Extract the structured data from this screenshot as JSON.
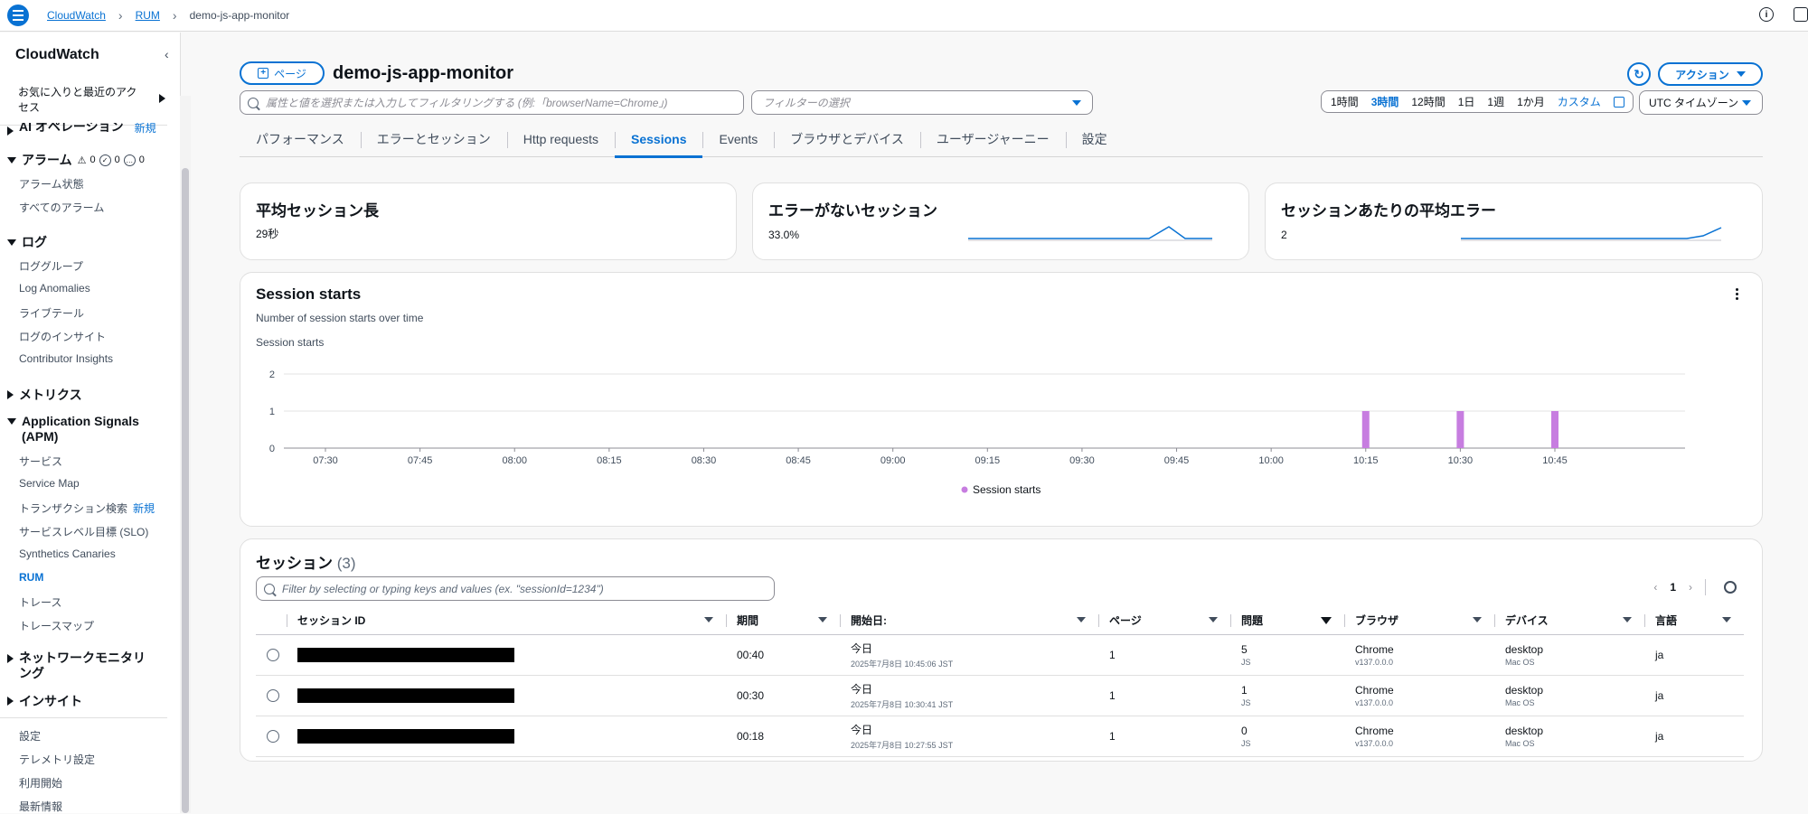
{
  "breadcrumb": {
    "items": [
      "CloudWatch",
      "RUM"
    ],
    "current": "demo-js-app-monitor"
  },
  "sidebar": {
    "title": "CloudWatch",
    "favorites": "お気に入りと最近のアクセス",
    "ai_label": "AI オペレーション",
    "new_tag": "新規",
    "alarms": {
      "label": "アラーム",
      "counts": [
        "0",
        "0",
        "0"
      ],
      "items": [
        "アラーム状態",
        "すべてのアラーム"
      ]
    },
    "logs": {
      "label": "ログ",
      "items": [
        "ロググループ",
        "Log Anomalies",
        "ライブテール",
        "ログのインサイト",
        "Contributor Insights"
      ]
    },
    "metrics": "メトリクス",
    "app_signals": {
      "label": "Application Signals (APM)",
      "items": [
        "サービス",
        "Service Map",
        "トランザクション検索",
        "サービスレベル目標 (SLO)",
        "Synthetics Canaries",
        "RUM",
        "トレース",
        "トレースマップ"
      ]
    },
    "network": "ネットワークモニタリング",
    "insights": "インサイト",
    "bottom": [
      "設定",
      "テレメトリ設定",
      "利用開始",
      "最新情報"
    ]
  },
  "header": {
    "page_button": "ページ",
    "title": "demo-js-app-monitor",
    "action_button": "アクション",
    "search_placeholder": "属性と値を選択または入力してフィルタリングする (例:「browserName=Chrome」)",
    "filter_placeholder": "フィルターの選択",
    "time_options": [
      "1時間",
      "3時間",
      "12時間",
      "1日",
      "1週",
      "1か月"
    ],
    "time_selected": "3時間",
    "custom": "カスタム",
    "timezone": "UTC タイムゾーン"
  },
  "tabs": [
    "パフォーマンス",
    "エラーとセッション",
    "Http requests",
    "Sessions",
    "Events",
    "ブラウザとデバイス",
    "ユーザージャーニー",
    "設定"
  ],
  "active_tab": "Sessions",
  "summary": [
    {
      "title": "平均セッション長",
      "value": "29秒"
    },
    {
      "title": "エラーがないセッション",
      "value": "33.0%"
    },
    {
      "title": "セッションあたりの平均エラー",
      "value": "2"
    }
  ],
  "chart_data": {
    "type": "bar",
    "title": "Session starts",
    "subtitle": "Number of session starts over time",
    "ylabel": "Session starts",
    "ylim": [
      0,
      2
    ],
    "yticks": [
      "0",
      "1",
      "2"
    ],
    "xticks": [
      "07:30",
      "07:45",
      "08:00",
      "08:15",
      "08:30",
      "08:45",
      "09:00",
      "09:15",
      "09:30",
      "09:45",
      "10:00",
      "10:15",
      "10:30",
      "10:45"
    ],
    "series": [
      {
        "name": "Session starts",
        "color": "#c77de0",
        "points": [
          {
            "x": "10:15",
            "y": 1
          },
          {
            "x": "10:30",
            "y": 1
          },
          {
            "x": "10:45",
            "y": 1
          }
        ]
      }
    ],
    "legend": "bottom-center"
  },
  "sessions": {
    "title": "セッション",
    "count": "(3)",
    "filter_placeholder": "Filter by selecting or typing keys and values (ex. \"sessionId=1234\")",
    "page": "1",
    "columns": [
      "セッション ID",
      "期間",
      "開始日:",
      "ページ",
      "問題",
      "ブラウザ",
      "デバイス",
      "言語"
    ],
    "rows": [
      {
        "duration": "00:40",
        "date": "今日",
        "date_sub": "2025年7月8日 10:45:06 JST",
        "pages": "1",
        "issues": "5",
        "issues_sub": "JS",
        "browser": "Chrome",
        "browser_sub": "v137.0.0.0",
        "device": "desktop",
        "device_sub": "Mac OS",
        "lang": "ja"
      },
      {
        "duration": "00:30",
        "date": "今日",
        "date_sub": "2025年7月8日 10:30:41 JST",
        "pages": "1",
        "issues": "1",
        "issues_sub": "JS",
        "browser": "Chrome",
        "browser_sub": "v137.0.0.0",
        "device": "desktop",
        "device_sub": "Mac OS",
        "lang": "ja"
      },
      {
        "duration": "00:18",
        "date": "今日",
        "date_sub": "2025年7月8日 10:27:55 JST",
        "pages": "1",
        "issues": "0",
        "issues_sub": "JS",
        "browser": "Chrome",
        "browser_sub": "v137.0.0.0",
        "device": "desktop",
        "device_sub": "Mac OS",
        "lang": "ja"
      }
    ]
  }
}
